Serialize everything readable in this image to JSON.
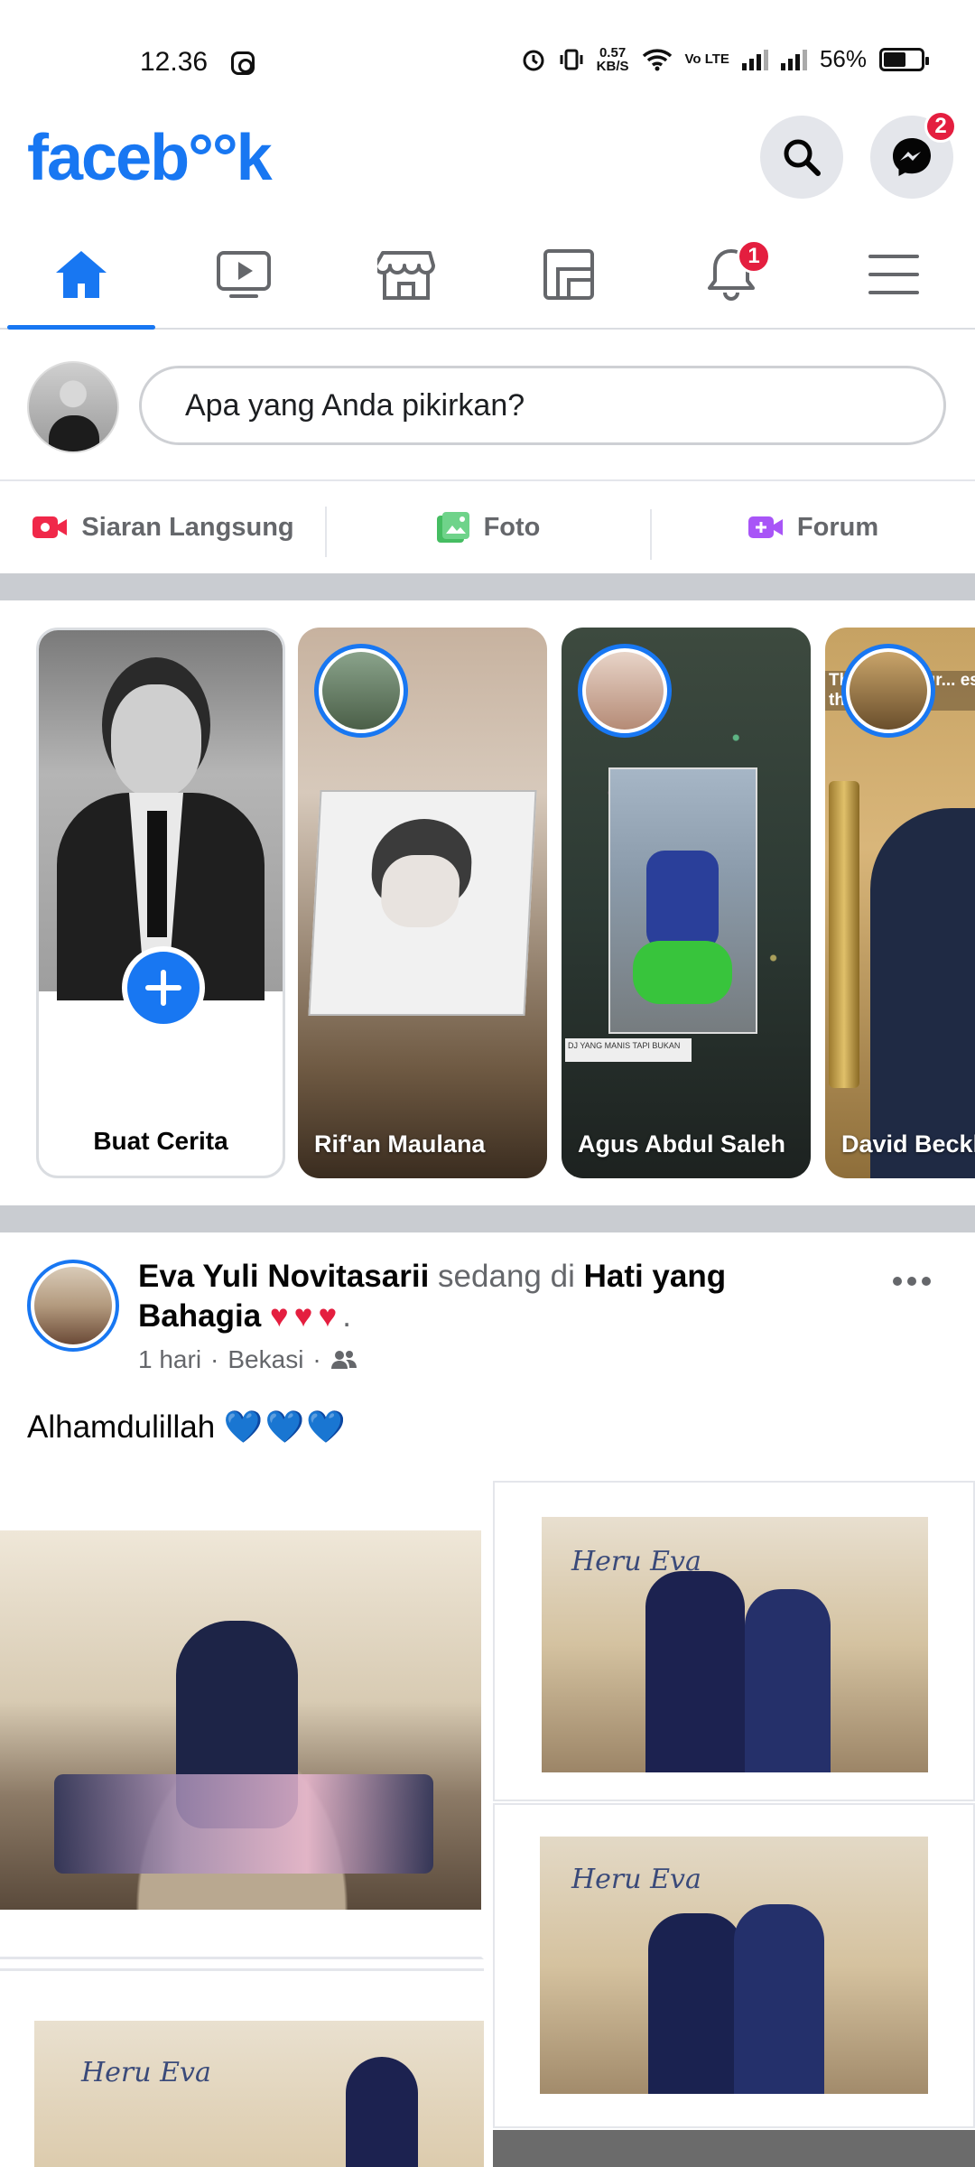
{
  "status": {
    "time": "12.36",
    "speed_value": "0.57",
    "speed_unit": "KB/S",
    "volte": "Vo LTE",
    "battery": "56%"
  },
  "header": {
    "logo": "faceb°°k",
    "messenger_badge": "2"
  },
  "nav": {
    "tabs": [
      {
        "name": "home",
        "icon": "home-icon",
        "active": true
      },
      {
        "name": "watch",
        "icon": "video-icon"
      },
      {
        "name": "marketplace",
        "icon": "store-icon"
      },
      {
        "name": "gaming",
        "icon": "feed-icon"
      },
      {
        "name": "notifications",
        "icon": "bell-icon",
        "badge": "1"
      },
      {
        "name": "menu",
        "icon": "menu-icon"
      }
    ],
    "notif_badge": "1"
  },
  "composer": {
    "placeholder": "Apa yang Anda pikirkan?"
  },
  "actions": {
    "live": "Siaran Langsung",
    "photo": "Foto",
    "room": "Forum"
  },
  "stories": {
    "create": "Buat Cerita",
    "items": [
      {
        "name": "Rif'an Maulana"
      },
      {
        "name": "Agus Abdul Saleh",
        "tag": "DJ YANG MANIS TAPI BUKAN"
      },
      {
        "name": "David Beckh",
        "overlay": "The... rings gr... es of v... host the Gam..."
      }
    ]
  },
  "post": {
    "author": "Eva Yuli Novitasarii",
    "connector": "sedang di",
    "place": "Hati yang Bahagia",
    "hearts": "♥♥♥",
    "period": ".",
    "time": "1 hari",
    "location": "Bekasi",
    "text": "Alhamdulillah",
    "text_emoji": "💙💙💙",
    "photo_script": "Heru Eva"
  },
  "colors": {
    "brand": "#1877f2",
    "badge": "#e41e3f",
    "muted": "#65676b"
  }
}
